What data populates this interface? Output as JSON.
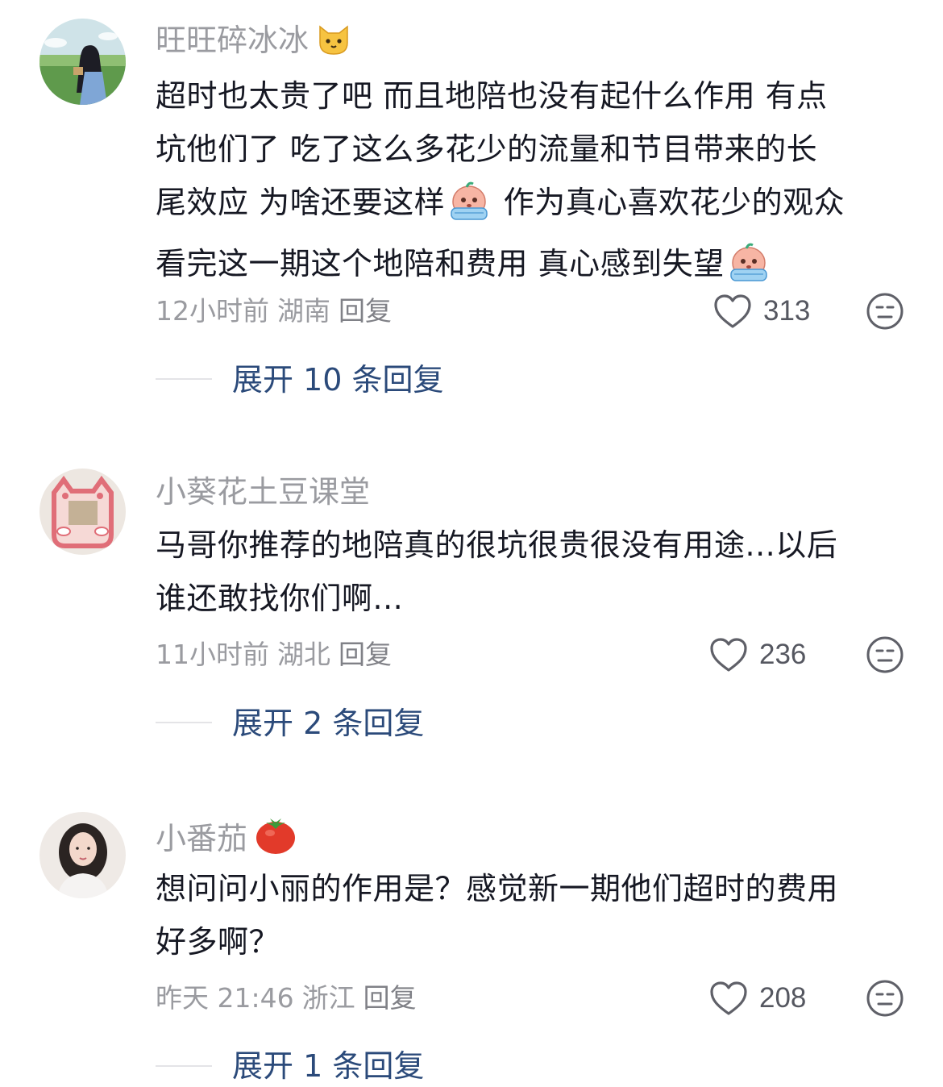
{
  "comments": [
    {
      "username": "旺旺碎冰冰",
      "username_emoji": "cat-face-emoji",
      "text_lines": [
        "超时也太贵了吧 而且地陪也没有起什么作用 有点",
        "坑他们了  吃了这么多花少的流量和节目带来的长",
        "尾效应 为啥还要这样",
        " 作为真心喜欢花少的观众",
        "看完这一期这个地陪和费用 真心感到失望"
      ],
      "time": "12小时前",
      "location": "湖南",
      "reply": "回复",
      "likes": "313",
      "expand": "展开 10 条回复"
    },
    {
      "username": "小葵花土豆课堂",
      "text_lines": [
        "马哥你推荐的地陪真的很坑很贵很没有用途...以后",
        "谁还敢找你们啊..."
      ],
      "time": "11小时前",
      "location": "湖北",
      "reply": "回复",
      "likes": "236",
      "expand": "展开 2 条回复"
    },
    {
      "username": "小番茄",
      "username_emoji": "tomato-emoji",
      "text_lines": [
        "想问问小丽的作用是？感觉新一期他们超时的费用",
        "好多啊？"
      ],
      "time": "昨天 21:46",
      "location": "浙江",
      "reply": "回复",
      "likes": "208",
      "expand": "展开 1 条回复"
    }
  ],
  "colors": {
    "username": "#9a9ba0",
    "text": "#161823",
    "meta": "#9a9ba0",
    "expand_link": "#2b4a7a"
  }
}
